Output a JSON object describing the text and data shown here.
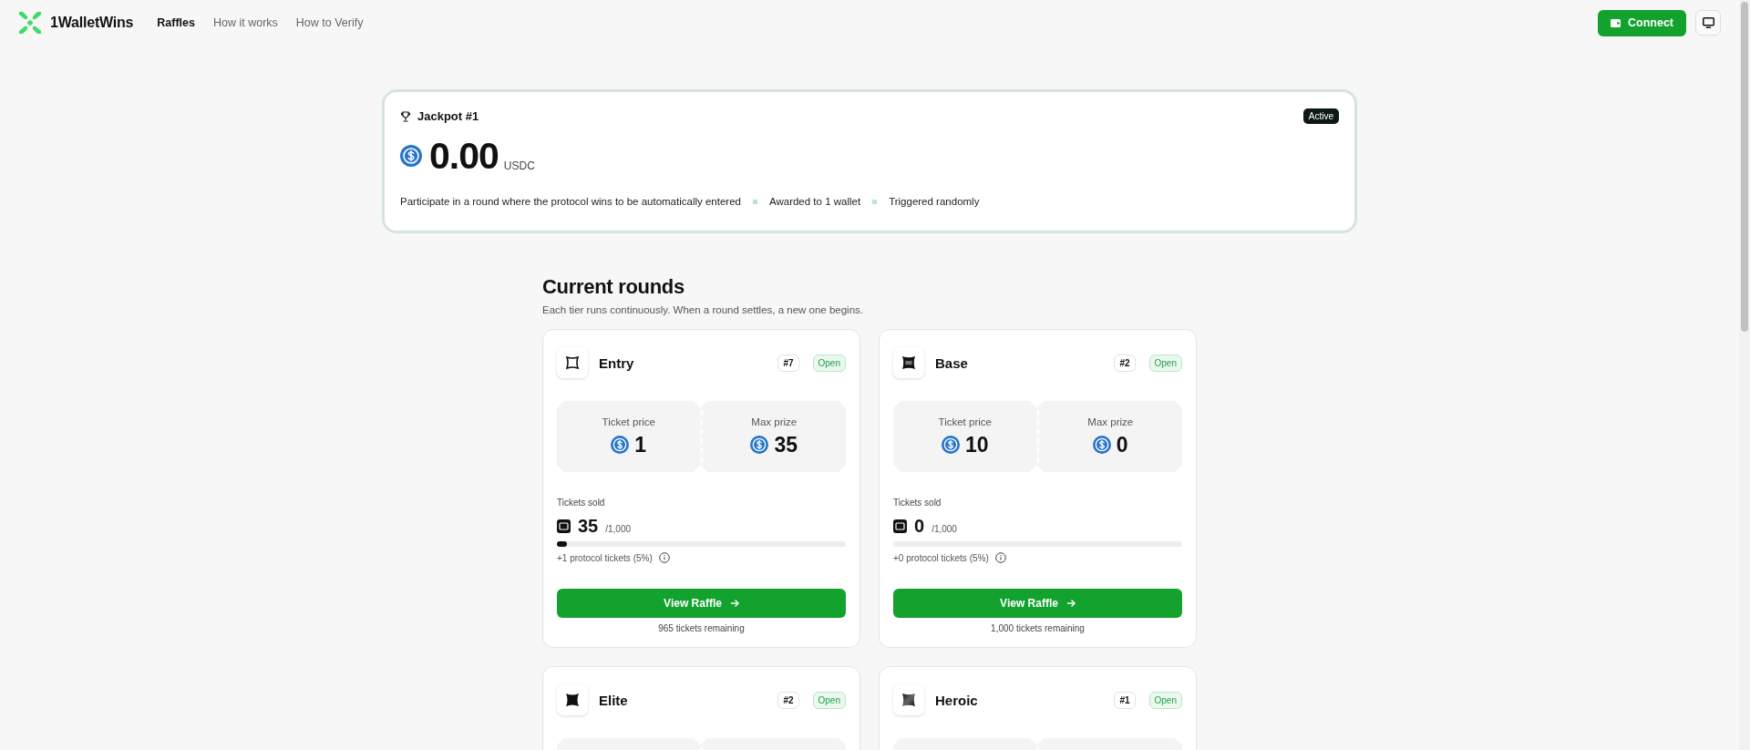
{
  "header": {
    "brand": "1WalletWins",
    "nav": [
      {
        "label": "Raffles",
        "selected": true
      },
      {
        "label": "How it works",
        "selected": false
      },
      {
        "label": "How to Verify",
        "selected": false
      }
    ],
    "connect_button": "Connect"
  },
  "jackpot": {
    "title": "Jackpot #1",
    "status": "Active",
    "amount": "0.00",
    "currency": "USDC",
    "description": "Participate in a round where the protocol wins to be automatically entered",
    "features": [
      "Awarded to 1 wallet",
      "Triggered randomly"
    ]
  },
  "rounds": {
    "title": "Current rounds",
    "subtitle": "Each tier runs continuously. When a round settles, a new one begins.",
    "cards": [
      {
        "name": "Entry",
        "kind": "outline",
        "number": "#7",
        "status": "Open",
        "ticket_price_label": "Ticket price",
        "ticket_price": "1",
        "max_prize_label": "Max prize",
        "max_prize": "35",
        "tickets_sold_label": "Tickets sold",
        "sold": "35",
        "total": "/1,000",
        "level": 0.035,
        "protocol": "+1 protocol tickets (5%)",
        "button": "View Raffle",
        "remaining": "965 tickets remaining"
      },
      {
        "name": "Base",
        "kind": "framed",
        "number": "#2",
        "status": "Open",
        "ticket_price_label": "Ticket price",
        "ticket_price": "10",
        "max_prize_label": "Max prize",
        "max_prize": "0",
        "tickets_sold_label": "Tickets sold",
        "sold": "0",
        "total": "/1,000",
        "level": 0,
        "protocol": "+0 protocol tickets (5%)",
        "button": "View Raffle",
        "remaining": "1,000 tickets remaining"
      },
      {
        "name": "Elite",
        "kind": "solid",
        "number": "#2",
        "status": "Open"
      },
      {
        "name": "Heroic",
        "kind": "shaded",
        "number": "#1",
        "status": "Open"
      }
    ]
  }
}
